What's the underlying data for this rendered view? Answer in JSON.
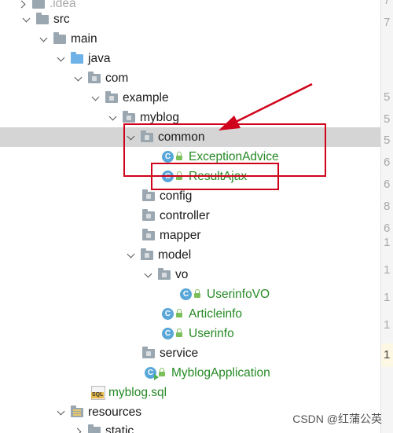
{
  "tree": {
    "rows": [
      {
        "label": ".idea",
        "arrow": "right",
        "icon": "folder",
        "type": "folder",
        "color": "plain"
      },
      {
        "label": "src",
        "arrow": "down",
        "icon": "folder",
        "type": "folder",
        "color": "plain"
      },
      {
        "label": "main",
        "arrow": "down",
        "icon": "folder",
        "type": "folder",
        "color": "plain"
      },
      {
        "label": "java",
        "arrow": "down",
        "icon": "folder-blue",
        "type": "source-folder",
        "color": "plain"
      },
      {
        "label": "com",
        "arrow": "down",
        "icon": "package",
        "type": "package",
        "color": "plain"
      },
      {
        "label": "example",
        "arrow": "down",
        "icon": "package",
        "type": "package",
        "color": "plain"
      },
      {
        "label": "myblog",
        "arrow": "down",
        "icon": "package",
        "type": "package",
        "color": "plain"
      },
      {
        "label": "common",
        "arrow": "down",
        "icon": "package",
        "type": "package",
        "color": "plain",
        "selected": true
      },
      {
        "label": "ExceptionAdvice",
        "arrow": "none",
        "icon": "class",
        "type": "class",
        "color": "green"
      },
      {
        "label": "ResultAjax",
        "arrow": "none",
        "icon": "class",
        "type": "class",
        "color": "green"
      },
      {
        "label": "config",
        "arrow": "none",
        "icon": "package",
        "type": "package",
        "color": "plain"
      },
      {
        "label": "controller",
        "arrow": "none",
        "icon": "package",
        "type": "package",
        "color": "plain"
      },
      {
        "label": "mapper",
        "arrow": "none",
        "icon": "package",
        "type": "package",
        "color": "plain"
      },
      {
        "label": "model",
        "arrow": "down",
        "icon": "package",
        "type": "package",
        "color": "plain"
      },
      {
        "label": "vo",
        "arrow": "down",
        "icon": "package",
        "type": "package",
        "color": "plain"
      },
      {
        "label": "UserinfoVO",
        "arrow": "none",
        "icon": "class",
        "type": "class",
        "color": "green"
      },
      {
        "label": "Articleinfo",
        "arrow": "none",
        "icon": "class",
        "type": "class",
        "color": "green"
      },
      {
        "label": "Userinfo",
        "arrow": "none",
        "icon": "class",
        "type": "class",
        "color": "green"
      },
      {
        "label": "service",
        "arrow": "none",
        "icon": "package",
        "type": "package",
        "color": "plain"
      },
      {
        "label": "MyblogApplication",
        "arrow": "none",
        "icon": "class-app",
        "type": "class",
        "color": "green"
      },
      {
        "label": "myblog.sql",
        "arrow": "none",
        "icon": "sql-file",
        "type": "file",
        "color": "green"
      },
      {
        "label": "resources",
        "arrow": "down",
        "icon": "folder-resources",
        "type": "resources-folder",
        "color": "plain"
      },
      {
        "label": "static",
        "arrow": "right",
        "icon": "folder",
        "type": "folder",
        "color": "plain"
      }
    ],
    "class_badge": "C",
    "sql_badge": "SQL"
  },
  "gutter": {
    "line_numbers": [
      "7",
      "7",
      "5",
      "5",
      "5",
      "6",
      "6",
      "8",
      "6",
      "",
      "",
      "1",
      "1",
      "1",
      "1",
      "",
      "",
      ""
    ],
    "current_line": "1"
  },
  "colors": {
    "selected_row": "#d5d5d5",
    "annotation_red": "#d0021b",
    "class_name_green": "#268a26",
    "class_icon_blue": "#59a7d8"
  },
  "watermark": "CSDN @红蒲公英"
}
